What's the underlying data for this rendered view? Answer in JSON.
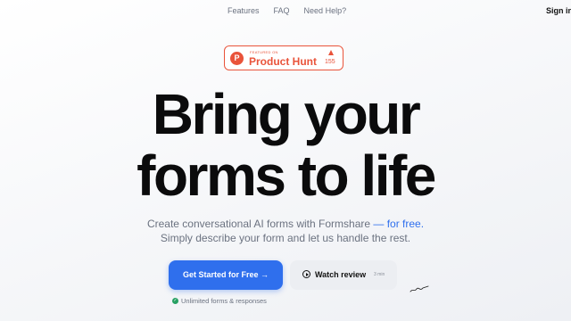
{
  "nav": {
    "links": [
      "Features",
      "FAQ",
      "Need Help?"
    ],
    "signin_label": "Sign in"
  },
  "badge": {
    "featured_label": "FEATURED ON",
    "name": "Product Hunt",
    "logo_letter": "P",
    "upvotes": "155",
    "color": "#e9533a"
  },
  "hero": {
    "headline_line1": "Bring your",
    "headline_line2": "forms to life",
    "subtitle_line1_prefix": "Create conversational AI forms with Formshare ",
    "subtitle_line1_accent": "— for free.",
    "subtitle_line2": "Simply describe your form and let us handle the rest."
  },
  "cta": {
    "primary_label": "Get Started for Free →",
    "secondary_label": "Watch review",
    "secondary_duration": "3 min",
    "primary_color": "#2f6fed"
  },
  "feature_note": "Unlimited forms & responses",
  "icons": {
    "play": "play-circle-icon",
    "check": "check-circle-icon",
    "producthunt": "product-hunt-logo",
    "upvote": "upvote-arrow-icon",
    "scribble": "scribble-decoration"
  }
}
